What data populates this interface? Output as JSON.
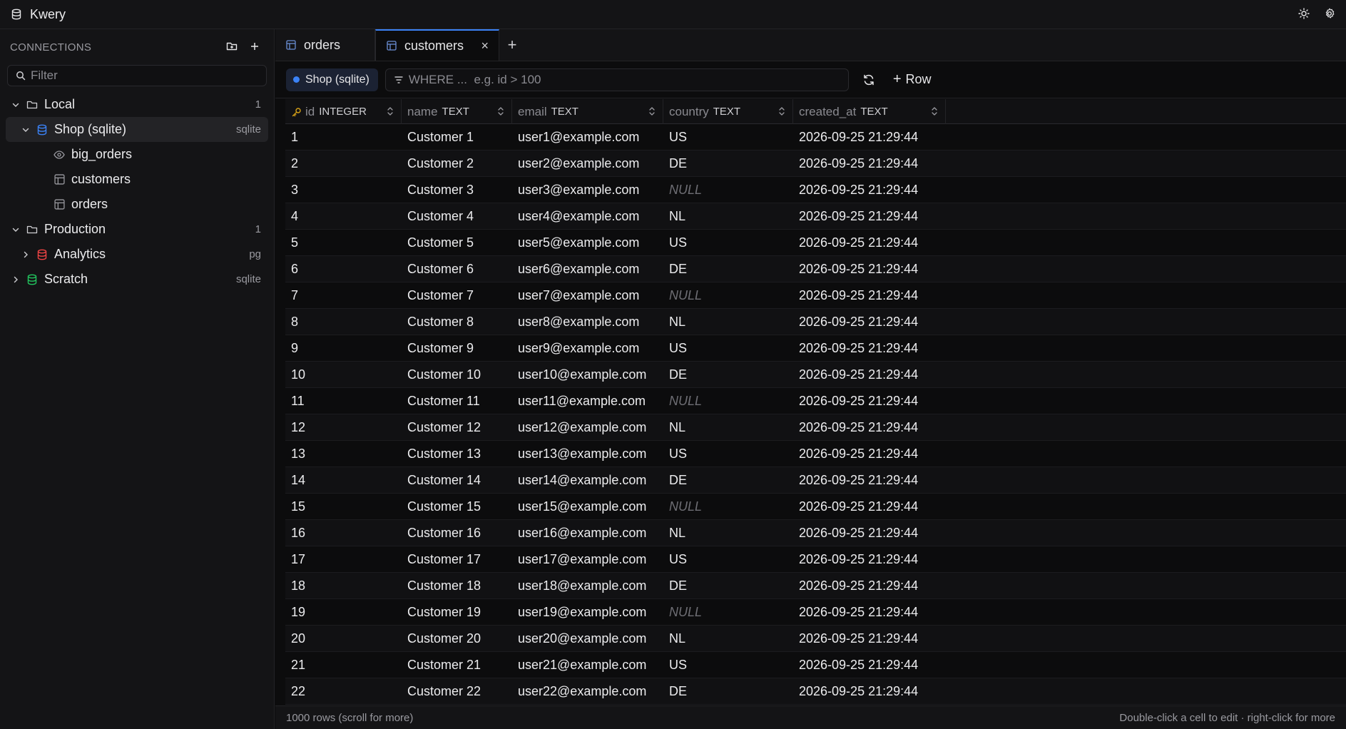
{
  "app": {
    "title": "Kwery"
  },
  "sidebar": {
    "header": "CONNECTIONS",
    "filter_placeholder": "Filter",
    "tree": [
      {
        "label": "Local",
        "meta": "1",
        "kind": "folder",
        "expanded": true,
        "depth": 0
      },
      {
        "label": "Shop (sqlite)",
        "meta": "sqlite",
        "kind": "db",
        "color": "#3b82f6",
        "expanded": true,
        "depth": 1,
        "selected": true
      },
      {
        "label": "big_orders",
        "meta": "",
        "kind": "view",
        "depth": 2
      },
      {
        "label": "customers",
        "meta": "",
        "kind": "table",
        "depth": 2
      },
      {
        "label": "orders",
        "meta": "",
        "kind": "table",
        "depth": 2
      },
      {
        "label": "Production",
        "meta": "1",
        "kind": "folder",
        "expanded": true,
        "depth": 0
      },
      {
        "label": "Analytics",
        "meta": "pg",
        "kind": "db",
        "color": "#ef4444",
        "expanded": false,
        "depth": 1
      },
      {
        "label": "Scratch",
        "meta": "sqlite",
        "kind": "db",
        "color": "#22c55e",
        "expanded": false,
        "depth": 0
      }
    ]
  },
  "tabs": [
    {
      "label": "orders",
      "active": false
    },
    {
      "label": "customers",
      "active": true,
      "close": "×"
    }
  ],
  "tab_add": "+",
  "toolbar": {
    "connection": "Shop (sqlite)",
    "where_placeholder": "WHERE ...  e.g. id > 100",
    "add_row": "Row",
    "add_row_plus": "+"
  },
  "columns": [
    {
      "name": "id",
      "type": "INTEGER",
      "key": true,
      "cls": "c-id"
    },
    {
      "name": "name",
      "type": "TEXT",
      "cls": "c-name"
    },
    {
      "name": "email",
      "type": "TEXT",
      "cls": "c-email"
    },
    {
      "name": "country",
      "type": "TEXT",
      "cls": "c-country"
    },
    {
      "name": "created_at",
      "type": "TEXT",
      "cls": "c-created"
    }
  ],
  "rows": [
    [
      "1",
      "Customer 1",
      "user1@example.com",
      "US",
      "2026-09-25 21:29:44"
    ],
    [
      "2",
      "Customer 2",
      "user2@example.com",
      "DE",
      "2026-09-25 21:29:44"
    ],
    [
      "3",
      "Customer 3",
      "user3@example.com",
      "NULL",
      "2026-09-25 21:29:44"
    ],
    [
      "4",
      "Customer 4",
      "user4@example.com",
      "NL",
      "2026-09-25 21:29:44"
    ],
    [
      "5",
      "Customer 5",
      "user5@example.com",
      "US",
      "2026-09-25 21:29:44"
    ],
    [
      "6",
      "Customer 6",
      "user6@example.com",
      "DE",
      "2026-09-25 21:29:44"
    ],
    [
      "7",
      "Customer 7",
      "user7@example.com",
      "NULL",
      "2026-09-25 21:29:44"
    ],
    [
      "8",
      "Customer 8",
      "user8@example.com",
      "NL",
      "2026-09-25 21:29:44"
    ],
    [
      "9",
      "Customer 9",
      "user9@example.com",
      "US",
      "2026-09-25 21:29:44"
    ],
    [
      "10",
      "Customer 10",
      "user10@example.com",
      "DE",
      "2026-09-25 21:29:44"
    ],
    [
      "11",
      "Customer 11",
      "user11@example.com",
      "NULL",
      "2026-09-25 21:29:44"
    ],
    [
      "12",
      "Customer 12",
      "user12@example.com",
      "NL",
      "2026-09-25 21:29:44"
    ],
    [
      "13",
      "Customer 13",
      "user13@example.com",
      "US",
      "2026-09-25 21:29:44"
    ],
    [
      "14",
      "Customer 14",
      "user14@example.com",
      "DE",
      "2026-09-25 21:29:44"
    ],
    [
      "15",
      "Customer 15",
      "user15@example.com",
      "NULL",
      "2026-09-25 21:29:44"
    ],
    [
      "16",
      "Customer 16",
      "user16@example.com",
      "NL",
      "2026-09-25 21:29:44"
    ],
    [
      "17",
      "Customer 17",
      "user17@example.com",
      "US",
      "2026-09-25 21:29:44"
    ],
    [
      "18",
      "Customer 18",
      "user18@example.com",
      "DE",
      "2026-09-25 21:29:44"
    ],
    [
      "19",
      "Customer 19",
      "user19@example.com",
      "NULL",
      "2026-09-25 21:29:44"
    ],
    [
      "20",
      "Customer 20",
      "user20@example.com",
      "NL",
      "2026-09-25 21:29:44"
    ],
    [
      "21",
      "Customer 21",
      "user21@example.com",
      "US",
      "2026-09-25 21:29:44"
    ],
    [
      "22",
      "Customer 22",
      "user22@example.com",
      "DE",
      "2026-09-25 21:29:44"
    ]
  ],
  "status": {
    "rows_text": "1000 rows (scroll for more)",
    "hint": "Double-click a cell to edit · right-click for more"
  },
  "icons": {
    "app": "database-icon",
    "theme": "sun-icon",
    "settings": "gear-icon",
    "new_folder": "folder-plus-icon",
    "add_connection": "plus-icon",
    "filter": "search-icon",
    "where": "filter-icon",
    "refresh": "refresh-icon",
    "primary_key": "key-icon",
    "sort": "sort-icon"
  }
}
